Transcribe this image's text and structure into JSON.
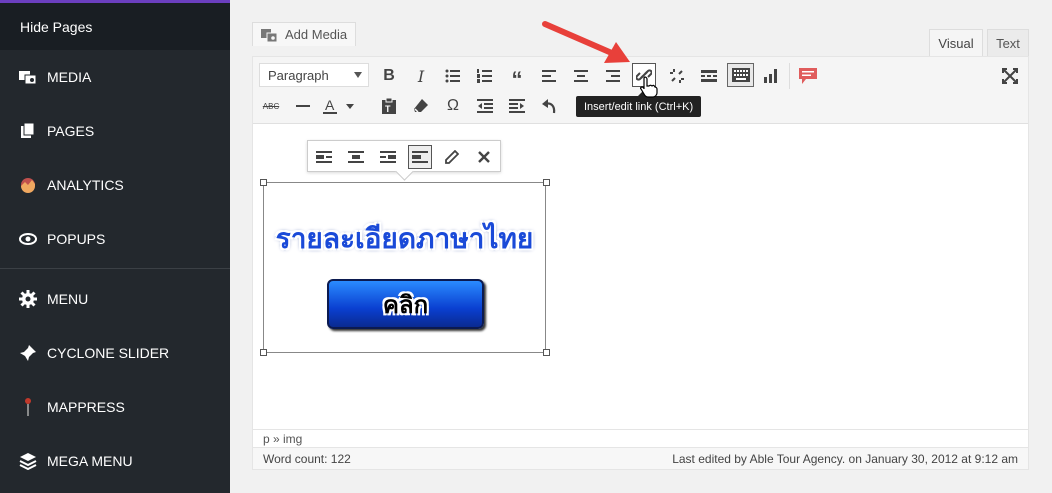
{
  "sidebar": {
    "top_label": "Hide Pages",
    "items": [
      {
        "label": "MEDIA",
        "icon": "media-icon"
      },
      {
        "label": "PAGES",
        "icon": "pages-icon"
      },
      {
        "label": "ANALYTICS",
        "icon": "analytics-icon"
      },
      {
        "label": "POPUPS",
        "icon": "popups-icon"
      },
      {
        "label": "MENU",
        "icon": "gear-icon"
      },
      {
        "label": "CYCLONE SLIDER",
        "icon": "pin-icon"
      },
      {
        "label": "MAPPRESS",
        "icon": "map-pin-icon"
      },
      {
        "label": "MEGA MENU",
        "icon": "layers-icon"
      }
    ]
  },
  "editor": {
    "add_media_label": "Add Media",
    "tabs": {
      "visual": "Visual",
      "text": "Text"
    },
    "format_select_value": "Paragraph",
    "tooltip": "Insert/edit link (Ctrl+K)",
    "image": {
      "title_text": "รายละเอียดภาษาไทย",
      "button_text": "คลิก"
    },
    "path": "p » img",
    "word_count": "Word count: 122",
    "last_edited": "Last edited by Able Tour Agency. on January 30, 2012 at 9:12 am"
  },
  "colors": {
    "sidebar_bg": "#23282d",
    "accent_arrow": "#e8403a",
    "tooltip_bg": "#222222"
  }
}
